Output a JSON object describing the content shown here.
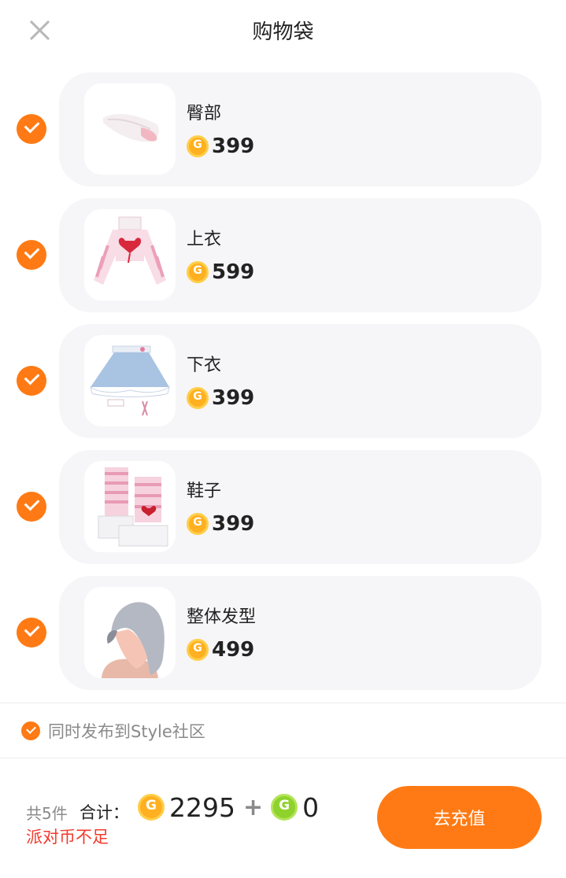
{
  "header": {
    "title": "购物袋",
    "close_icon": "close-icon"
  },
  "items": [
    {
      "name": "臀部",
      "price": "399",
      "selected": true,
      "thumb_icon": "tail-icon"
    },
    {
      "name": "上衣",
      "price": "599",
      "selected": true,
      "thumb_icon": "top-icon"
    },
    {
      "name": "下衣",
      "price": "399",
      "selected": true,
      "thumb_icon": "skirt-icon"
    },
    {
      "name": "鞋子",
      "price": "399",
      "selected": true,
      "thumb_icon": "boots-icon"
    },
    {
      "name": "整体发型",
      "price": "499",
      "selected": true,
      "thumb_icon": "hair-icon"
    }
  ],
  "publish": {
    "label": "同时发布到Style社区",
    "checked": true
  },
  "footer": {
    "count_label": "共5件",
    "total_label": "合计：",
    "gold_total": "2295",
    "plus": "+",
    "green_total": "0",
    "warning": "派对币不足",
    "button_label": "去充值"
  },
  "colors": {
    "accent": "#ff7a14",
    "warning": "#f23a2c",
    "gold_coin": "#ffb020",
    "green_coin": "#8fd22c"
  }
}
